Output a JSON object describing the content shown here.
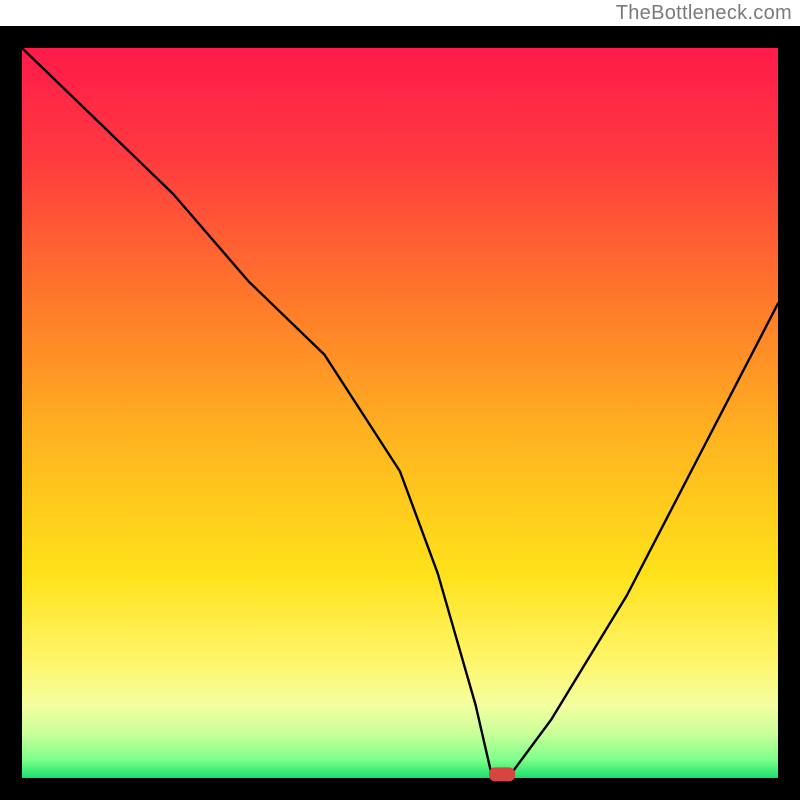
{
  "watermark": "TheBottleneck.com",
  "chart_data": {
    "type": "line",
    "title": "",
    "xlabel": "",
    "ylabel": "",
    "xlim": [
      0,
      100
    ],
    "ylim": [
      0,
      100
    ],
    "x": [
      0,
      10,
      20,
      30,
      40,
      50,
      55,
      60,
      62,
      65,
      70,
      80,
      90,
      100
    ],
    "values": [
      100,
      90,
      80,
      68,
      58,
      42,
      28,
      10,
      1,
      1,
      8,
      25,
      45,
      65
    ],
    "notes": "Bottleneck curve: descends from top-left, dips to near zero around x≈62-65, then rises toward the right. Background is a vertical gradient from red (top) through orange/yellow to a thin green strip at the bottom, inside a black frame. A small red rounded marker sits at the curve minimum.",
    "marker": {
      "x": 63.5,
      "y": 0.5
    },
    "gradient_stops": [
      {
        "offset": 0.0,
        "color": "#ff1a4a"
      },
      {
        "offset": 0.15,
        "color": "#ff3a3f"
      },
      {
        "offset": 0.35,
        "color": "#ff7a2a"
      },
      {
        "offset": 0.55,
        "color": "#ffb81f"
      },
      {
        "offset": 0.72,
        "color": "#ffe21a"
      },
      {
        "offset": 0.84,
        "color": "#fff56a"
      },
      {
        "offset": 0.9,
        "color": "#f4ffa0"
      },
      {
        "offset": 0.94,
        "color": "#c8ff9a"
      },
      {
        "offset": 0.975,
        "color": "#7eff8c"
      },
      {
        "offset": 1.0,
        "color": "#18e06a"
      }
    ],
    "frame_color": "#000000"
  }
}
